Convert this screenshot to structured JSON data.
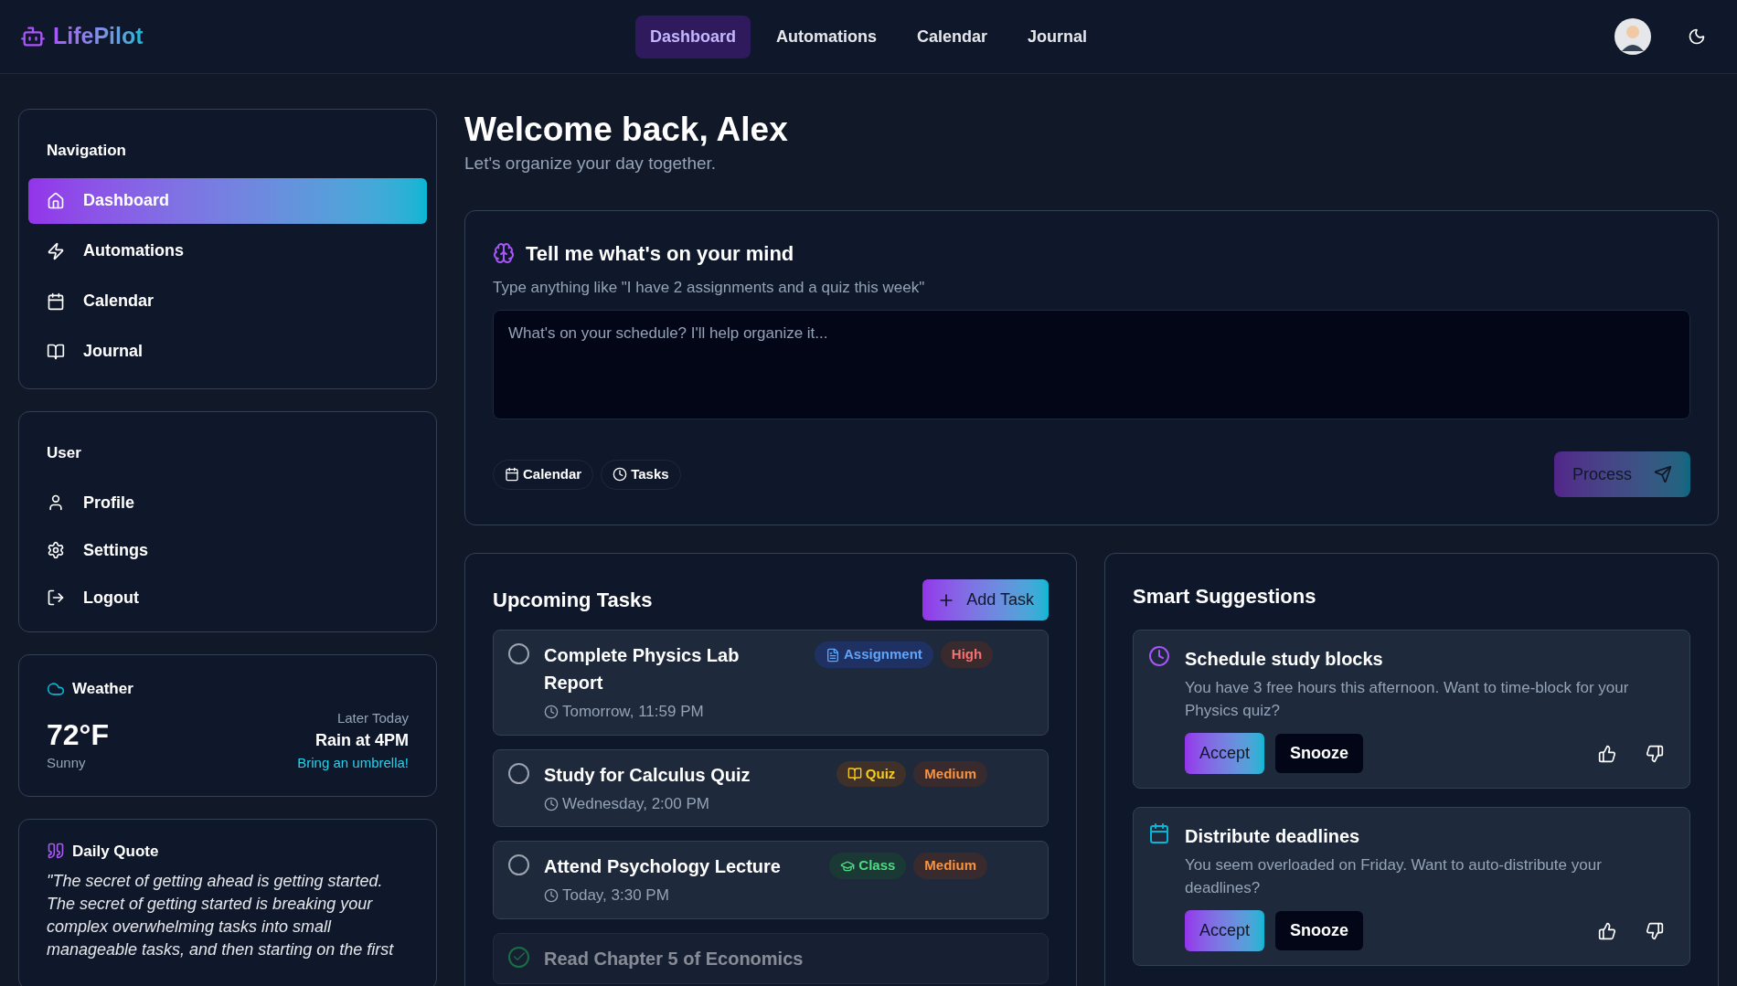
{
  "brand": "LifePilot",
  "top_nav": [
    {
      "label": "Dashboard",
      "selected": true
    },
    {
      "label": "Automations",
      "selected": false
    },
    {
      "label": "Calendar",
      "selected": false
    },
    {
      "label": "Journal",
      "selected": false
    }
  ],
  "sidebar": {
    "navigation": {
      "title": "Navigation",
      "items": [
        {
          "label": "Dashboard",
          "kind": "home",
          "selected": true
        },
        {
          "label": "Automations",
          "kind": "bolt",
          "selected": false
        },
        {
          "label": "Calendar",
          "kind": "calendar",
          "selected": false
        },
        {
          "label": "Journal",
          "kind": "book",
          "selected": false
        }
      ]
    },
    "user": {
      "title": "User",
      "items": [
        {
          "label": "Profile",
          "kind": "user"
        },
        {
          "label": "Settings",
          "kind": "gear"
        },
        {
          "label": "Logout",
          "kind": "logout"
        }
      ]
    },
    "weather": {
      "title": "Weather",
      "temperature": "72°F",
      "condition": "Sunny",
      "later_label": "Later Today",
      "forecast": "Rain at 4PM",
      "advice": "Bring an umbrella!"
    },
    "quote": {
      "title": "Daily Quote",
      "text": "\"The secret of getting ahead is getting started. The secret of getting started is breaking your complex overwhelming tasks into small manageable tasks, and then starting on the first"
    }
  },
  "welcome": {
    "title": "Welcome back, Alex",
    "subtitle": "Let's organize your day together."
  },
  "mind": {
    "title": "Tell me what's on your mind",
    "hint": "Type anything like \"I have 2 assignments and a quiz this week\"",
    "placeholder": "What's on your schedule? I'll help organize it...",
    "chips": [
      {
        "label": "Calendar",
        "kind": "calendar"
      },
      {
        "label": "Tasks",
        "kind": "clock"
      }
    ],
    "button": {
      "label": "Process",
      "disabled": true
    }
  },
  "tasks": {
    "title": "Upcoming Tasks",
    "add_button": "Add Task",
    "items": [
      {
        "title": "Complete Physics Lab Report",
        "due": "Tomorrow, 11:59 PM",
        "done": false,
        "type": {
          "label": "Assignment",
          "kind": "assignment"
        },
        "priority": {
          "label": "High",
          "color": "#f87171"
        }
      },
      {
        "title": "Study for Calculus Quiz",
        "due": "Wednesday, 2:00 PM",
        "done": false,
        "type": {
          "label": "Quiz",
          "kind": "quiz"
        },
        "priority": {
          "label": "Medium",
          "color": "#fb923c"
        }
      },
      {
        "title": "Attend Psychology Lecture",
        "due": "Today, 3:30 PM",
        "done": false,
        "type": {
          "label": "Class",
          "kind": "class"
        },
        "priority": {
          "label": "Medium",
          "color": "#fb923c"
        }
      },
      {
        "title": "Read Chapter 5 of Economics",
        "done": true
      }
    ]
  },
  "suggestions": {
    "title": "Smart Suggestions",
    "items": [
      {
        "kind": "clock",
        "title": "Schedule study blocks",
        "text": "You have 3 free hours this afternoon. Want to time-block for your Physics quiz?",
        "accept": "Accept",
        "snooze": "Snooze"
      },
      {
        "kind": "calendar",
        "title": "Distribute deadlines",
        "text": "You seem overloaded on Friday. Want to auto-distribute your deadlines?",
        "accept": "Accept",
        "snooze": "Snooze"
      }
    ]
  }
}
